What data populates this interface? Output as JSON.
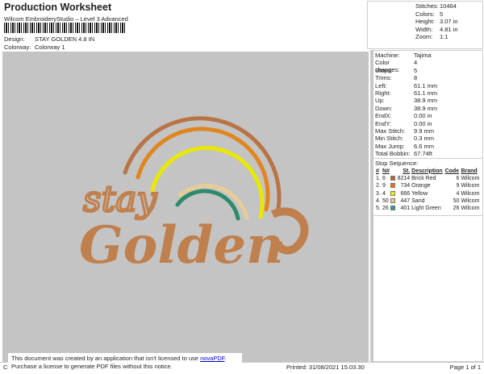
{
  "header": {
    "title": "Production Worksheet",
    "subtitle": "Wilcom EmbroideryStudio – Level 3 Advanced",
    "design_label": "Design:",
    "design_value": "STAY GOLDEN 4.8 IN",
    "colorway_label": "Colorway:",
    "colorway_value": "Colorway 1"
  },
  "stats": [
    {
      "k": "Stitches:",
      "v": "10464"
    },
    {
      "k": "Colors:",
      "v": "5"
    },
    {
      "k": "Height:",
      "v": "3.07 in"
    },
    {
      "k": "Width:",
      "v": "4.81 in"
    },
    {
      "k": "Zoom:",
      "v": "1:1"
    }
  ],
  "properties": [
    {
      "k": "Machine:",
      "v": "Tajima"
    },
    {
      "k": "Color changes:",
      "v": "4"
    },
    {
      "k": "Stops:",
      "v": "5"
    },
    {
      "k": "Trims:",
      "v": "8"
    },
    {
      "k": "Left:",
      "v": "61.1 mm"
    },
    {
      "k": "Right:",
      "v": "61.1 mm"
    },
    {
      "k": "Up:",
      "v": "38.9 mm"
    },
    {
      "k": "Down:",
      "v": "38.9 mm"
    },
    {
      "k": "EndX:",
      "v": "0.00 in"
    },
    {
      "k": "EndY:",
      "v": "0.00 in"
    },
    {
      "k": "Max Stitch:",
      "v": "9.9 mm"
    },
    {
      "k": "Min Stitch:",
      "v": "0.3 mm"
    },
    {
      "k": "Max Jump:",
      "v": "6.6 mm"
    },
    {
      "k": "Total Bobbin:",
      "v": "67.74ft"
    }
  ],
  "stop_sequence": {
    "title": "Stop Sequence:",
    "headers": [
      "#",
      "N#",
      "St.",
      "Description",
      "Code",
      "Brand"
    ],
    "rows": [
      {
        "idx": "1.",
        "n": "6",
        "color": "#b5653a",
        "st": "8214",
        "desc": "Brick Red",
        "code": "6",
        "brand": "Wilcom"
      },
      {
        "idx": "2.",
        "n": "9",
        "color": "#e8761e",
        "st": "734",
        "desc": "Orange",
        "code": "9",
        "brand": "Wilcom"
      },
      {
        "idx": "3.",
        "n": "4",
        "color": "#f4f000",
        "st": "666",
        "desc": "Yellow",
        "code": "4",
        "brand": "Wilcom"
      },
      {
        "idx": "4.",
        "n": "50",
        "color": "#f0c896",
        "st": "447",
        "desc": "Sand",
        "code": "50",
        "brand": "Wilcom"
      },
      {
        "idx": "5.",
        "n": "26",
        "color": "#2e9a78",
        "st": "401",
        "desc": "Light Green",
        "code": "26",
        "brand": "Wilcom"
      }
    ]
  },
  "design": {
    "word1": "stay",
    "word2": "Golden",
    "text_color": "#c0804e",
    "arc_colors": [
      "#b87444",
      "#e0861e",
      "#e8e800",
      "#e8cc98",
      "#2e8a6c"
    ]
  },
  "footer": {
    "notice_line1": "This document was created by an application that isn't licensed to use ",
    "notice_link": "novaPDF",
    "notice_end": ".",
    "notice_line2": "Purchase a license to generate PDF files without this notice.",
    "cr": "Cr",
    "printed": "Printed: 31/08/2021 15.03.30",
    "page": "Page 1 of 1"
  }
}
